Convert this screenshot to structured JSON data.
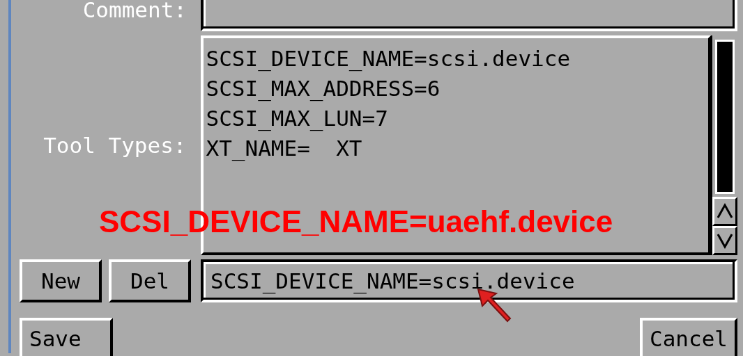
{
  "comment": {
    "label": "Comment:"
  },
  "tool_types": {
    "label": "Tool Types:",
    "entries": [
      "SCSI_DEVICE_NAME=scsi.device",
      "SCSI_MAX_ADDRESS=6",
      "SCSI_MAX_LUN=7",
      "XT_NAME=  XT"
    ],
    "input_value": "SCSI_DEVICE_NAME=scsi.device"
  },
  "list_buttons": [
    "New",
    "Del"
  ],
  "footer_buttons": [
    "Save",
    "Cancel"
  ],
  "overlay_caption": "SCSI_DEVICE_NAME=uaehf.device"
}
